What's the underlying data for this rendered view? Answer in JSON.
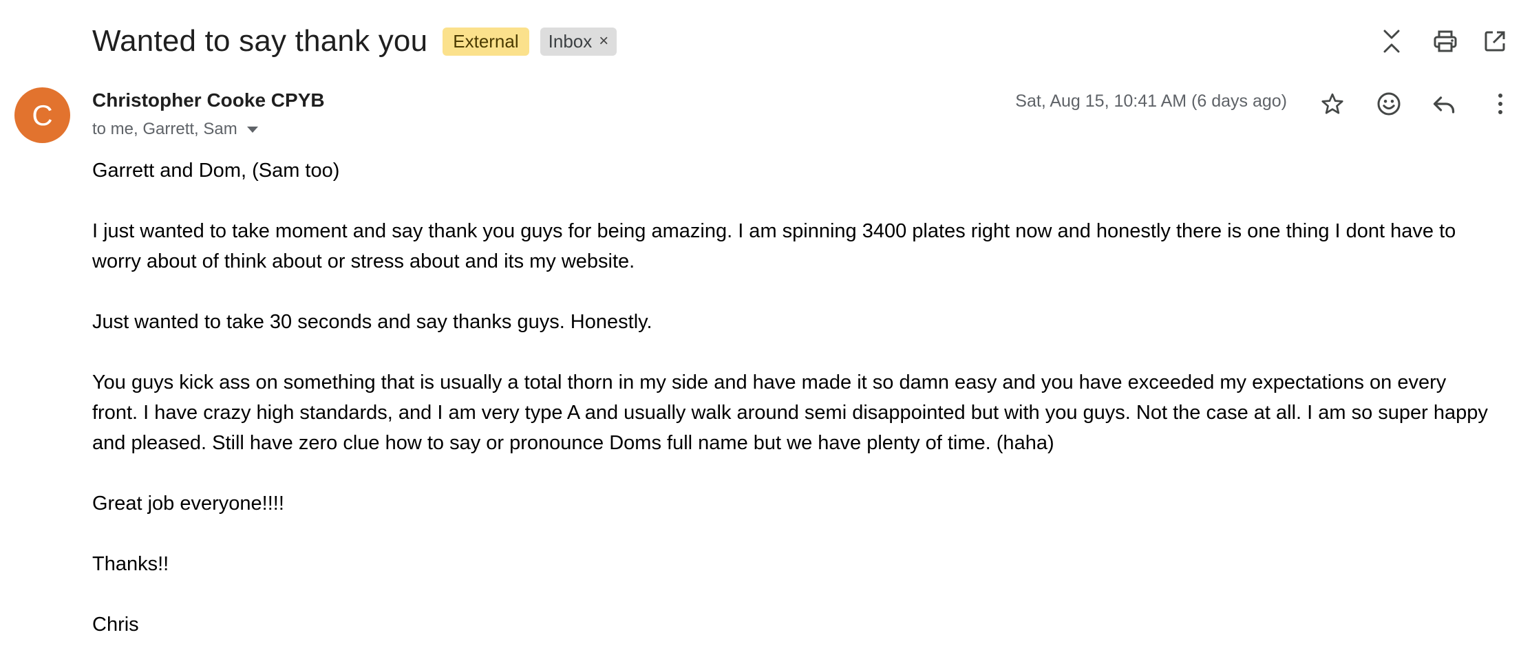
{
  "email": {
    "subject": "Wanted to say thank you",
    "labels": {
      "external": "External",
      "inbox": "Inbox",
      "remove_symbol": "×"
    },
    "sender": {
      "avatar_initial": "C",
      "name": "Christopher Cooke CPYB",
      "recipients": "to me, Garrett, Sam",
      "date": "Sat, Aug 15, 10:41 AM (6 days ago)"
    },
    "body": {
      "p1": "Garrett and Dom, (Sam too)",
      "p2": "I just wanted to take moment and say thank you guys for being amazing. I am spinning 3400 plates right now and honestly there is one thing I dont have to worry about of think about or stress about and its my website.",
      "p3": "Just wanted to take 30 seconds and say thanks guys.  Honestly.",
      "p4": "You guys kick ass on something that is usually a total thorn in my side and have made it so damn easy and you have exceeded my expectations on every front. I have crazy high standards, and I am very type A and usually walk around semi disappointed but with you guys. Not the case at all.  I am so super happy and pleased. Still have zero clue how to say or pronounce Doms full name but we have plenty of time. (haha)",
      "p5": "Great job everyone!!!!",
      "p6": "Thanks!!",
      "p7": "Chris"
    }
  },
  "icons": {
    "top": [
      "collapse-all-icon",
      "print-icon",
      "open-in-new-window-icon"
    ],
    "message": [
      "star-icon",
      "emoji-reaction-icon",
      "reply-icon",
      "more-vert-icon"
    ]
  },
  "colors": {
    "avatar": "#e2732e",
    "external_label": "#fbe18c",
    "inbox_label": "#dddddd",
    "secondary_text": "#5f6368"
  }
}
